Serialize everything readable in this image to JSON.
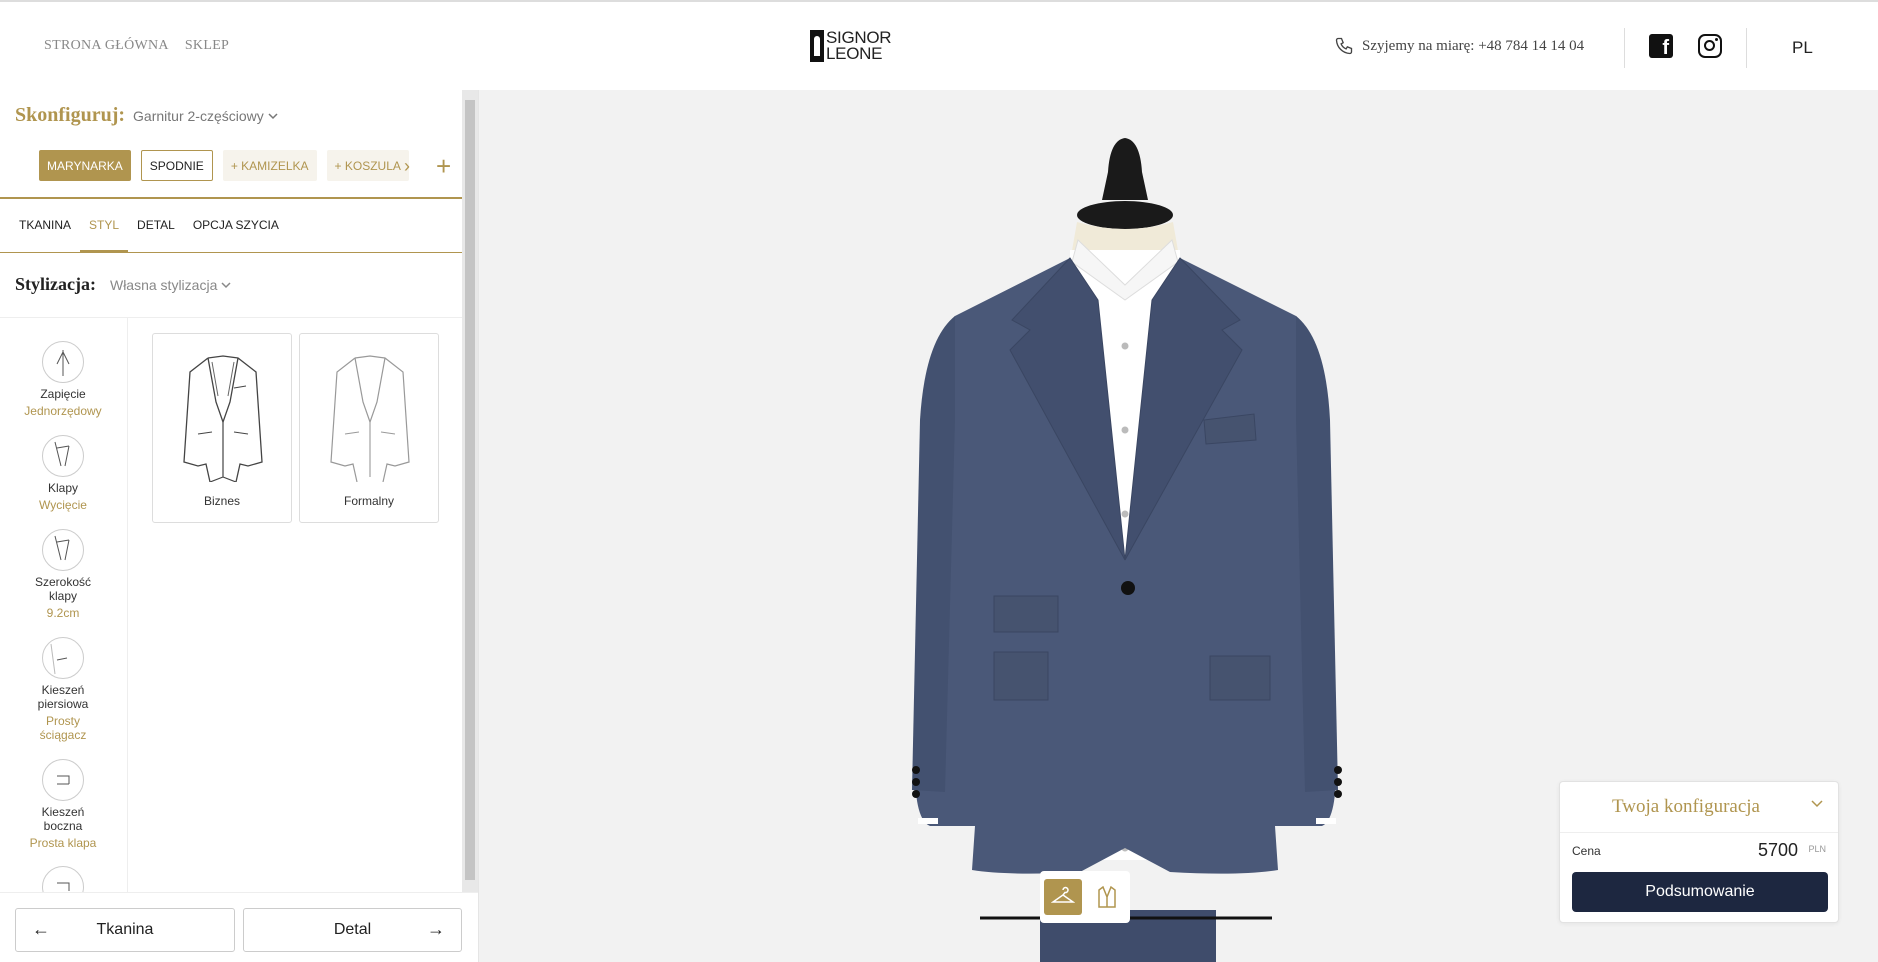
{
  "header": {
    "nav": [
      "STRONA GŁÓWNA",
      "SKLEP"
    ],
    "logo": {
      "line1": "SIGNOR",
      "line2": "LEONE"
    },
    "phone_text": "Szyjemy na miarę: +48 784 14 14 04",
    "language": "PL",
    "icons": [
      "phone-icon",
      "facebook-icon",
      "instagram-icon"
    ]
  },
  "configure": {
    "label": "Skonfiguruj:",
    "value": "Garnitur 2-częściowy"
  },
  "pieces": [
    {
      "label": "MARYNARKA",
      "state": "active"
    },
    {
      "label": "SPODNIE",
      "state": "outline"
    },
    {
      "label": "+ KAMIZELKA",
      "state": "add"
    },
    {
      "label": "+ KOSZULA",
      "state": "add"
    }
  ],
  "tabs": [
    "TKANINA",
    "STYL",
    "DETAL",
    "OPCJA SZYCIA"
  ],
  "active_tab": "STYL",
  "styling": {
    "label": "Stylizacja:",
    "value": "Własna stylizacja"
  },
  "options": [
    {
      "name": "Zapięcie",
      "value": "Jednorzędowy"
    },
    {
      "name": "Klapy",
      "value": "Wycięcie"
    },
    {
      "name": "Szerokość klapy",
      "value": "9.2cm"
    },
    {
      "name": "Kieszeń piersiowa",
      "value": "Prosty ściągacz"
    },
    {
      "name": "Kieszeń boczna",
      "value": "Prosta klapa"
    }
  ],
  "style_cards": [
    "Biznes",
    "Formalny"
  ],
  "bottom_nav": {
    "prev": "Tkanina",
    "next": "Detal"
  },
  "summary": {
    "title": "Twoja konfiguracja",
    "price_label": "Cena",
    "price_value": "5700",
    "currency": "PLN",
    "button": "Podsumowanie"
  },
  "colors": {
    "accent": "#b0954f",
    "button_dark": "#1d2740",
    "suit": "#4a5878"
  }
}
